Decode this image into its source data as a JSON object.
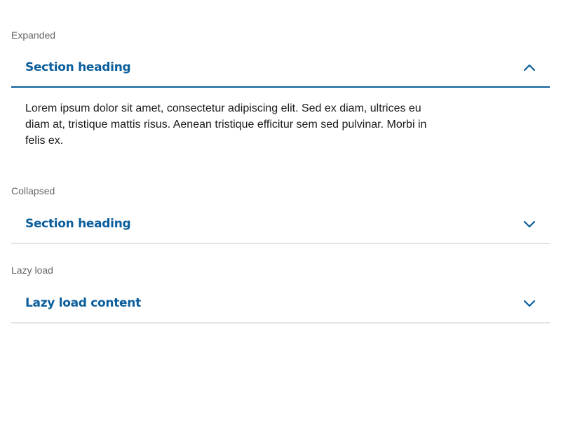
{
  "colors": {
    "accent": "#0b5e9c",
    "label": "#666666",
    "divider": "#e3e3e3",
    "body_text": "#1a1a1a"
  },
  "examples": [
    {
      "label": "Expanded",
      "heading": "Section heading",
      "state": "expanded",
      "icon": "chevron-up-icon",
      "content": "Lorem ipsum dolor sit amet, consectetur adipiscing elit. Sed ex diam, ultrices eu diam at, tristique mattis risus. Aenean tristique efficitur sem sed pulvinar. Morbi in felis ex."
    },
    {
      "label": "Collapsed",
      "heading": "Section heading",
      "state": "collapsed",
      "icon": "chevron-down-icon"
    },
    {
      "label": "Lazy load",
      "heading": "Lazy load content",
      "state": "collapsed",
      "icon": "chevron-down-icon"
    }
  ]
}
